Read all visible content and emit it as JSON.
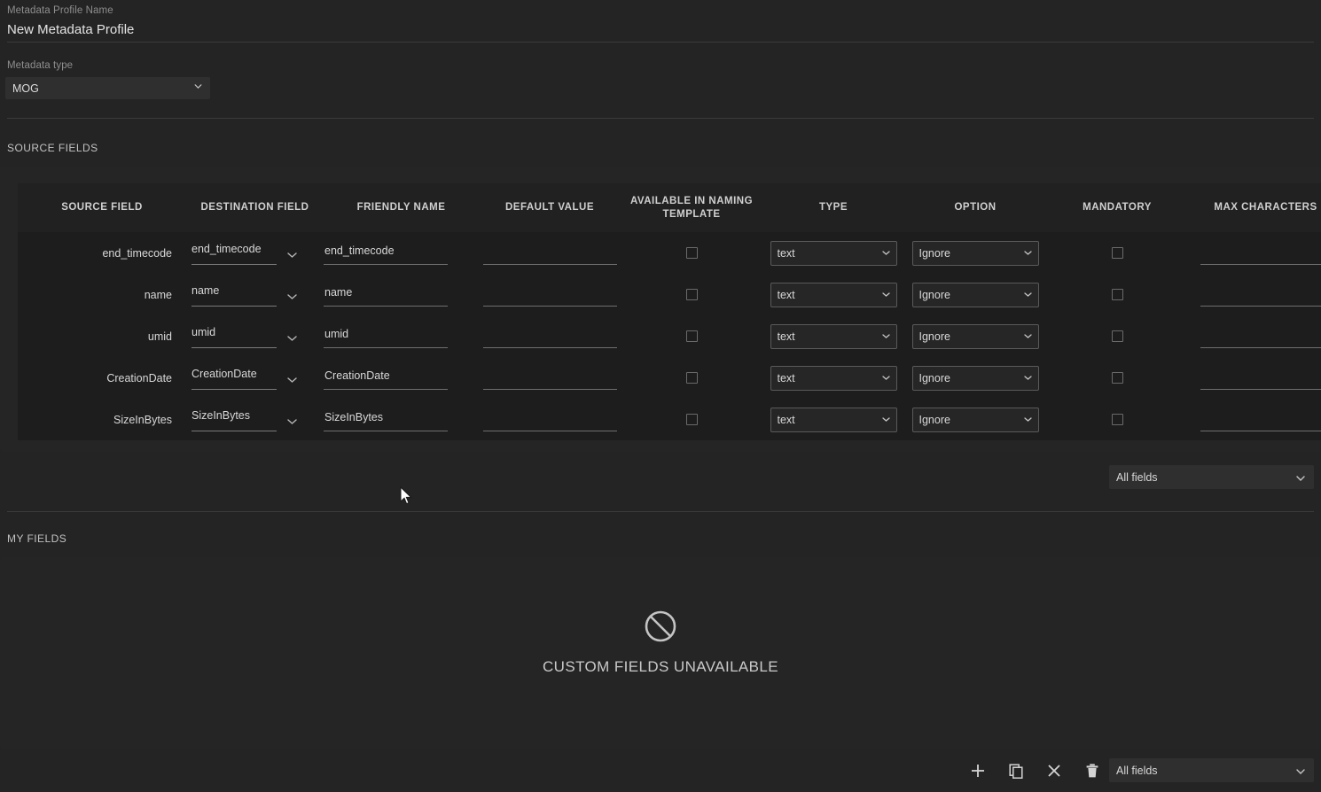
{
  "profile": {
    "name_caption": "Metadata Profile Name",
    "name_value": "New Metadata Profile",
    "type_caption": "Metadata type",
    "type_value": "MOG",
    "type_options": [
      "MOG"
    ]
  },
  "sections": {
    "source_fields_heading": "SOURCE FIELDS",
    "my_fields_heading": "MY FIELDS"
  },
  "table": {
    "columns": [
      "SOURCE FIELD",
      "DESTINATION FIELD",
      "FRIENDLY NAME",
      "DEFAULT VALUE",
      "AVAILABLE IN NAMING TEMPLATE",
      "TYPE",
      "OPTION",
      "MANDATORY",
      "MAX CHARACTERS"
    ],
    "rows": [
      {
        "source_field": "end_timecode",
        "destination_field": "end_timecode",
        "friendly_name": "end_timecode",
        "default_value": "",
        "available_in_naming_template": false,
        "type": "text",
        "option": "Ignore",
        "mandatory": false,
        "max_characters": ""
      },
      {
        "source_field": "name",
        "destination_field": "name",
        "friendly_name": "name",
        "default_value": "",
        "available_in_naming_template": false,
        "type": "text",
        "option": "Ignore",
        "mandatory": false,
        "max_characters": ""
      },
      {
        "source_field": "umid",
        "destination_field": "umid",
        "friendly_name": "umid",
        "default_value": "",
        "available_in_naming_template": false,
        "type": "text",
        "option": "Ignore",
        "mandatory": false,
        "max_characters": ""
      },
      {
        "source_field": "CreationDate",
        "destination_field": "CreationDate",
        "friendly_name": "CreationDate",
        "default_value": "",
        "available_in_naming_template": false,
        "type": "text",
        "option": "Ignore",
        "mandatory": false,
        "max_characters": ""
      },
      {
        "source_field": "SizeInBytes",
        "destination_field": "SizeInBytes",
        "friendly_name": "SizeInBytes",
        "default_value": "",
        "available_in_naming_template": false,
        "type": "text",
        "option": "Ignore",
        "mandatory": false,
        "max_characters": ""
      }
    ],
    "type_options": [
      "text"
    ],
    "option_options": [
      "Ignore"
    ]
  },
  "source_filter": {
    "value": "All fields",
    "options": [
      "All fields"
    ]
  },
  "my_fields": {
    "empty_icon": "no-entry-icon",
    "empty_text": "CUSTOM FIELDS UNAVAILABLE"
  },
  "bottom_toolbar": {
    "buttons": [
      {
        "name": "add-field-button",
        "icon": "plus-icon"
      },
      {
        "name": "duplicate-field-button",
        "icon": "copy-icon"
      },
      {
        "name": "remove-field-button",
        "icon": "close-x-icon"
      },
      {
        "name": "delete-field-button",
        "icon": "trash-icon"
      }
    ],
    "filter": {
      "value": "All fields",
      "options": [
        "All fields"
      ]
    }
  },
  "theme": {
    "background": "#242424",
    "panel": "#252525",
    "table_background": "#1d1d1d",
    "table_header": "#212121",
    "control_background": "#2f2f2f",
    "text_primary": "#d8d8d8",
    "text_muted": "#8e8e8e",
    "divider": "#3b3b3b"
  }
}
